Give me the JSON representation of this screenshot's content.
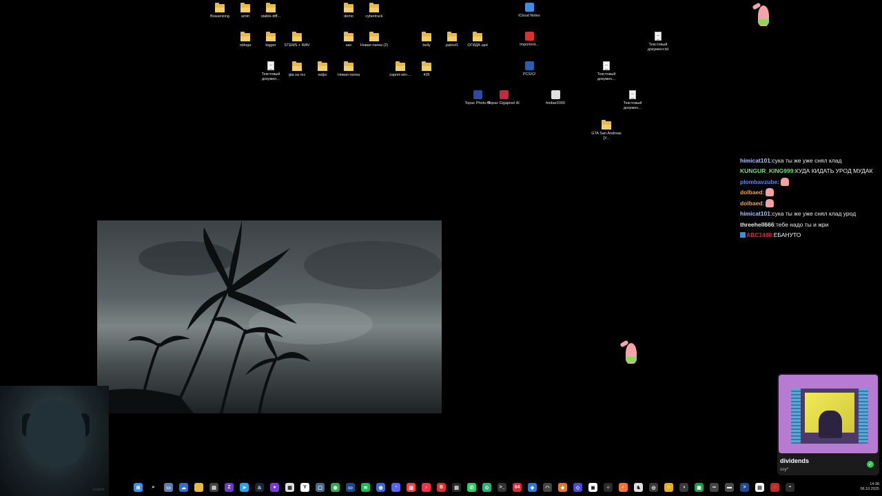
{
  "desktop": {
    "icons": [
      {
        "label": "Brauerizing",
        "type": "folder"
      },
      {
        "label": "amiri",
        "type": "folder"
      },
      {
        "label": "stable-diff...",
        "type": "folder"
      },
      {
        "label": "demo",
        "type": "folder"
      },
      {
        "label": "cybertruck",
        "type": "folder"
      },
      {
        "label": "iCloud Notes",
        "type": "app",
        "icon": "icloud-notes-icon",
        "color": "#3d8fe0"
      },
      {
        "label": "obloga",
        "type": "folder"
      },
      {
        "label": "bigger",
        "type": "folder"
      },
      {
        "label": "STEMS + WAV",
        "type": "folder"
      },
      {
        "label": "san",
        "type": "folder"
      },
      {
        "label": "Новая папка (2)",
        "type": "folder"
      },
      {
        "label": "belly",
        "type": "folder"
      },
      {
        "label": "patriot1",
        "type": "folder"
      },
      {
        "label": "ОГИДА upd",
        "type": "folder"
      },
      {
        "label": "importent...",
        "type": "app",
        "icon": "pdf-icon",
        "color": "#d83232"
      },
      {
        "label": "Текстовый документ.txt",
        "type": "doc"
      },
      {
        "label": "Текстовый докумен...",
        "type": "doc"
      },
      {
        "label": "gta sa rez",
        "type": "folder"
      },
      {
        "label": "екфо",
        "type": "folder"
      },
      {
        "label": "Новая папка",
        "type": "folder"
      },
      {
        "label": "zapret-win-...",
        "type": "folder"
      },
      {
        "label": "435",
        "type": "folder"
      },
      {
        "label": "PCSX2",
        "type": "app",
        "icon": "pcsx2-icon",
        "color": "#2a5fb0"
      },
      {
        "label": "Текстовый докумен...",
        "type": "doc"
      },
      {
        "label": "Topaz Photo AI",
        "type": "app",
        "icon": "topaz-photo-icon",
        "color": "#2c4aa8"
      },
      {
        "label": "Topaz Gigapixel AI",
        "type": "app",
        "icon": "topaz-gigapixel-icon",
        "color": "#c8283c"
      },
      {
        "label": "foobar2000",
        "type": "app",
        "icon": "foobar-icon",
        "color": "#e0e0e0"
      },
      {
        "label": "Текстовый докумен...",
        "type": "doc"
      },
      {
        "label": "GTA San Andreas [У...",
        "type": "folder"
      }
    ]
  },
  "chat": {
    "messages": [
      {
        "user": "himicat101",
        "color": "#a9c6ff",
        "text": "сука ты же уже снял клад",
        "emotes": 0
      },
      {
        "user": "KUNGUR_KING999",
        "color": "#6fe07a",
        "text": "КУДА КИДАТЬ УРОД МУДАК",
        "emotes": 0
      },
      {
        "user": "plombavzube",
        "color": "#4a8cff",
        "text": "",
        "emotes": 1
      },
      {
        "user": "dolbaed",
        "color": "#ff9d35",
        "text": "",
        "emotes": 1
      },
      {
        "user": "dolbaed",
        "color": "#ff9d35",
        "text": "",
        "emotes": 1
      },
      {
        "user": "himicat101",
        "color": "#a9c6ff",
        "text": "сука ты же уже снял клад урод",
        "emotes": 0
      },
      {
        "user": "threehell666",
        "color": "#e6e6e6",
        "text": "тебе надо ты и жри",
        "emotes": 0
      },
      {
        "user": "ABC1488",
        "color": "#e0263c",
        "text": "ЕБАНУТО",
        "emotes": 0,
        "badge": true
      }
    ]
  },
  "music": {
    "title": "dividends",
    "artist": "ssy*",
    "accent": "#2ecc55"
  },
  "webcam": {
    "label": "ss@tntr"
  },
  "taskbar": {
    "icons": [
      {
        "name": "start-icon",
        "color": "#3b8eea",
        "glyph": "⊞"
      },
      {
        "name": "search-icon",
        "color": "#000000",
        "glyph": "⌕"
      },
      {
        "name": "task-view-icon",
        "color": "#5a7fb0",
        "glyph": "▭"
      },
      {
        "name": "widgets-icon",
        "color": "#2f6fd0",
        "glyph": "☁"
      },
      {
        "name": "file-explorer-icon",
        "color": "#e7b84a",
        "glyph": ""
      },
      {
        "name": "app-icon",
        "color": "#444444",
        "glyph": "▤"
      },
      {
        "name": "obs-icon",
        "color": "#6a3ac8",
        "glyph": "Z"
      },
      {
        "name": "telegram-icon",
        "color": "#2aa3e0",
        "glyph": "➤"
      },
      {
        "name": "steam-icon",
        "color": "#1b2838",
        "glyph": "♨"
      },
      {
        "name": "app-icon",
        "color": "#7a3ad8",
        "glyph": "●"
      },
      {
        "name": "calendar-icon",
        "color": "#e0e0e0",
        "glyph": "▦"
      },
      {
        "name": "yandex-icon",
        "color": "#ffffff",
        "glyph": "Y"
      },
      {
        "name": "app-icon",
        "color": "#4a6a8a",
        "glyph": "▢"
      },
      {
        "name": "chrome-icon",
        "color": "#34a853",
        "glyph": "◉"
      },
      {
        "name": "app-icon",
        "color": "#1a4a8a",
        "glyph": "▭"
      },
      {
        "name": "spotify-icon",
        "color": "#1db954",
        "glyph": "≋"
      },
      {
        "name": "app-icon",
        "color": "#3a6ad8",
        "glyph": "◍"
      },
      {
        "name": "discord-icon",
        "color": "#5865f2",
        "glyph": "◔"
      },
      {
        "name": "app-icon",
        "color": "#ff4040",
        "glyph": "▥"
      },
      {
        "name": "music-icon",
        "color": "#fa2d48",
        "glyph": "♪"
      },
      {
        "name": "app-icon",
        "color": "#e03030",
        "glyph": "B"
      },
      {
        "name": "app-icon",
        "color": "#2a2a2a",
        "glyph": "▤"
      },
      {
        "name": "whatsapp-icon",
        "color": "#25d366",
        "glyph": "✆"
      },
      {
        "name": "app-icon",
        "color": "#2ab07a",
        "glyph": "⊙"
      },
      {
        "name": "terminal-icon",
        "color": "#333333",
        "glyph": ">_"
      },
      {
        "name": "app-icon",
        "color": "#d82a3a",
        "glyph": "64"
      },
      {
        "name": "vscode-icon",
        "color": "#2f7ad8",
        "glyph": "◈"
      },
      {
        "name": "speedometer-icon",
        "color": "#444444",
        "glyph": "◠"
      },
      {
        "name": "app-icon",
        "color": "#e07a2a",
        "glyph": "◆"
      },
      {
        "name": "app-icon",
        "color": "#4a4ad8",
        "glyph": "◇"
      },
      {
        "name": "app-icon",
        "color": "#ffffff",
        "glyph": "◼"
      },
      {
        "name": "app-icon",
        "color": "#2a2a2a",
        "glyph": "⁘"
      },
      {
        "name": "firefox-icon",
        "color": "#ff7139",
        "glyph": "◐"
      },
      {
        "name": "app-icon",
        "color": "#e0e0e0",
        "glyph": "♞"
      },
      {
        "name": "app-icon",
        "color": "#3a3a3a",
        "glyph": "◎"
      },
      {
        "name": "app-icon",
        "color": "#e0b020",
        "glyph": "☺"
      },
      {
        "name": "app-icon",
        "color": "#3a3a3a",
        "glyph": "◑"
      },
      {
        "name": "app-icon",
        "color": "#1e9a4a",
        "glyph": "▣"
      },
      {
        "name": "app-icon",
        "color": "#444444",
        "glyph": "∞"
      },
      {
        "name": "app-icon",
        "color": "#4a4a4a",
        "glyph": "▬"
      },
      {
        "name": "powershell-icon",
        "color": "#1e4a8a",
        "glyph": ">"
      },
      {
        "name": "app-icon",
        "color": "#ffffff",
        "glyph": "▤"
      },
      {
        "name": "app-icon",
        "color": "#c02a2a",
        "glyph": "◌"
      },
      {
        "name": "app-icon",
        "color": "#2a2a2a",
        "glyph": "◓"
      }
    ]
  },
  "clock": {
    "time": "14:38",
    "date": "06.10.2025"
  }
}
